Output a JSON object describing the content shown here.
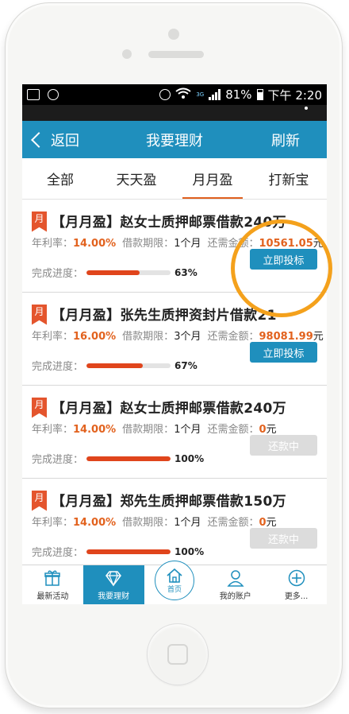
{
  "statusbar": {
    "network": "3G",
    "battery": "81%",
    "time": "下午 2:20"
  },
  "topbar": {
    "back_label": "返回",
    "title": "我要理财",
    "refresh_label": "刷新"
  },
  "tabs": [
    {
      "label": "全部"
    },
    {
      "label": "天天盈"
    },
    {
      "label": "月月盈",
      "active": true
    },
    {
      "label": "打新宝"
    }
  ],
  "labels": {
    "flag": "月",
    "rate": "年利率：",
    "term": "借款期限：",
    "remaining": "还需金额：",
    "progress": "完成进度：",
    "yuan": "元"
  },
  "items": [
    {
      "title": "【月月盈】赵女士质押邮票借款240万",
      "rate": "14.00%",
      "term": "1个月",
      "remaining": "10561.05",
      "progress_pct": 63,
      "progress_label": "63%",
      "button": "立即投标",
      "button_state": "invest"
    },
    {
      "title": "【月月盈】张先生质押资封片借款21",
      "rate": "16.00%",
      "term": "3个月",
      "remaining": "98081.99",
      "progress_pct": 67,
      "progress_label": "67%",
      "button": "立即投标",
      "button_state": "invest"
    },
    {
      "title": "【月月盈】赵女士质押邮票借款240万",
      "rate": "14.00%",
      "term": "1个月",
      "remaining": "0",
      "progress_pct": 100,
      "progress_label": "100%",
      "button": "还款中",
      "button_state": "repay"
    },
    {
      "title": "【月月盈】郑先生质押邮票借款150万",
      "rate": "14.00%",
      "term": "1个月",
      "remaining": "0",
      "progress_pct": 100,
      "progress_label": "100%",
      "button": "还款中",
      "button_state": "repay"
    }
  ],
  "bottomnav": [
    {
      "label": "最新活动",
      "icon": "gift-icon"
    },
    {
      "label": "我要理财",
      "icon": "diamond-icon",
      "active": true
    },
    {
      "label": "首页",
      "icon": "home-icon"
    },
    {
      "label": "我的账户",
      "icon": "user-icon"
    },
    {
      "label": "更多...",
      "icon": "plus-circle-icon"
    }
  ],
  "colors": {
    "primary": "#1f8fbd",
    "accent": "#e2621e",
    "highlight": "#f4a11c"
  }
}
